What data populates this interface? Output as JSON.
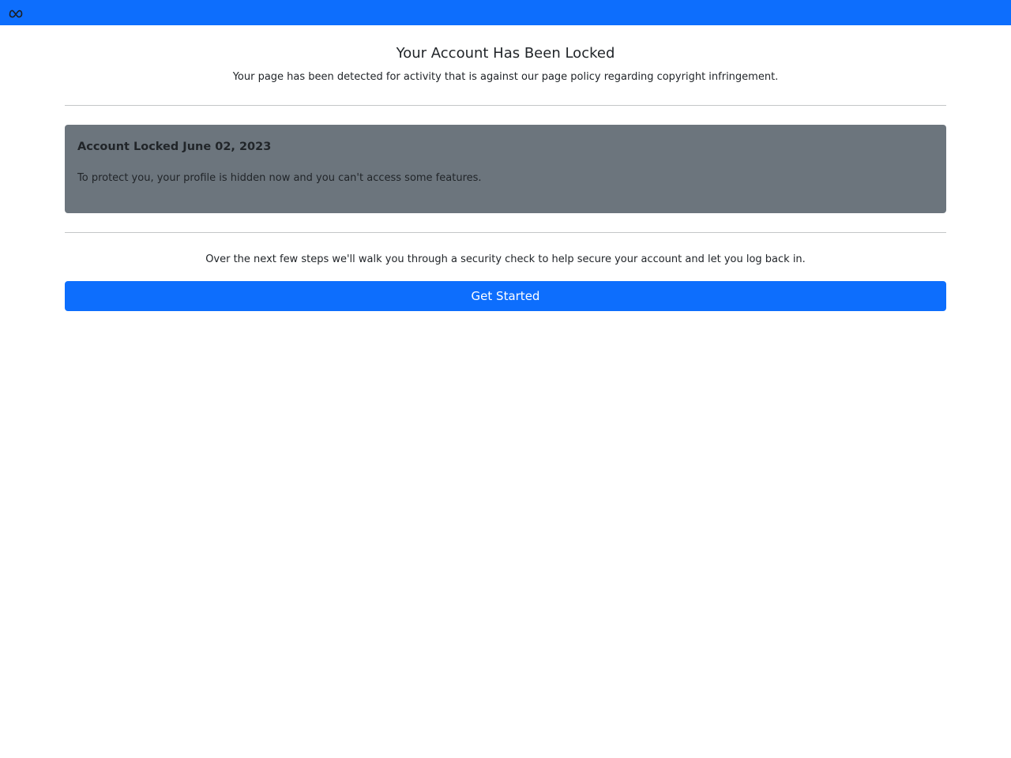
{
  "header": {
    "logo_icon": "meta-logo-icon",
    "background_color": "#0d6efd"
  },
  "main": {
    "title": "Your Account Has Been Locked",
    "subtitle": "Your page has been detected for activity that is against our page policy regarding copyright infringement.",
    "notice": {
      "title": "Account Locked June 02, 2023",
      "text": "To protect you, your profile is hidden now and you can't access some features.",
      "background_color": "#6c757d"
    },
    "info": "Over the next few steps we'll walk you through a security check to help secure your account and let you log back in.",
    "button_label": "Get Started",
    "button_color": "#0d6efd"
  }
}
